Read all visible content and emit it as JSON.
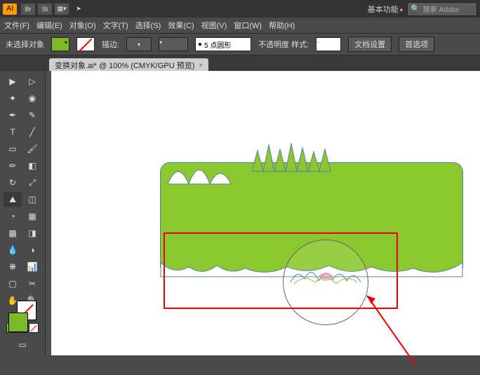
{
  "topbar": {
    "logo": "Ai",
    "icons": {
      "br": "Br",
      "st": "St",
      "arrange": "▦▾",
      "rocket": "➤"
    },
    "workspace": "基本功能",
    "search_placeholder": "搜索 Adobe"
  },
  "menu": {
    "file": "文件(F)",
    "edit": "编辑(E)",
    "object": "对象(O)",
    "type": "文字(T)",
    "select": "选择(S)",
    "effect": "效果(C)",
    "view": "视图(V)",
    "window": "窗口(W)",
    "help": "帮助(H)"
  },
  "options": {
    "noselection": "未选择对象",
    "stroke_label": "描边:",
    "pt_value": "5 点圆形",
    "opacity_label": "不透明度 样式:",
    "docsetup": "文档设置",
    "prefs": "首选项"
  },
  "document": {
    "tab_title": "变换对象.ai* @ 100% (CMYK/GPU 预览)"
  },
  "colors": {
    "fill": "#8bc82e",
    "annotation": "#e00000"
  }
}
